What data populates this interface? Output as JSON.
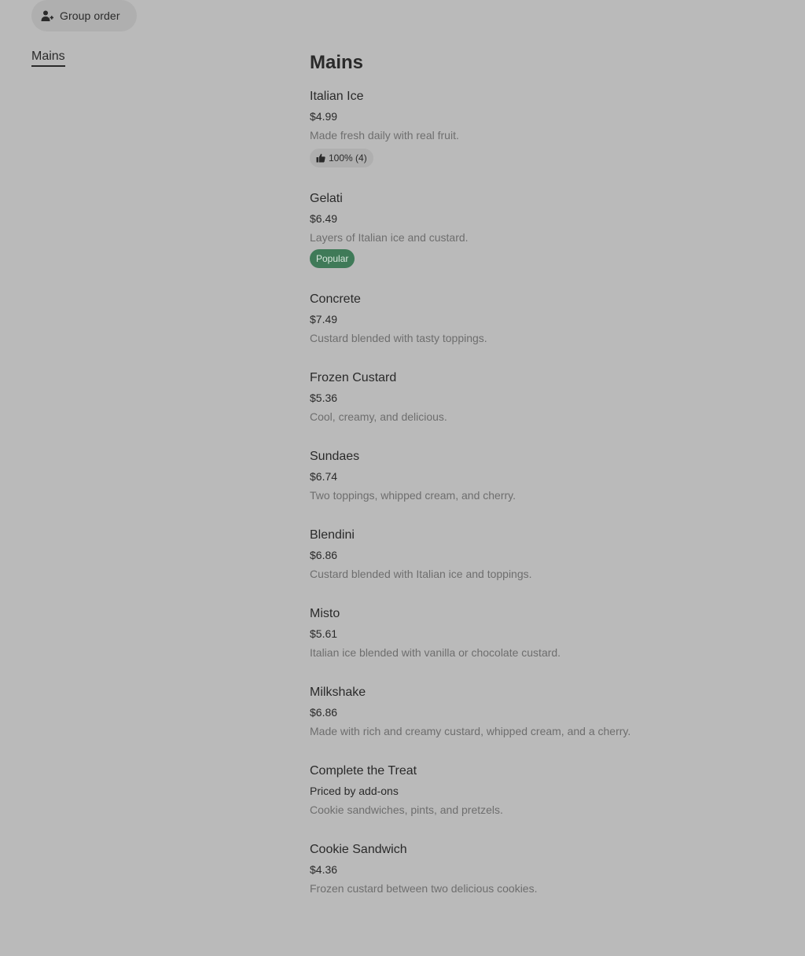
{
  "header": {
    "group_order_label": "Group order",
    "group_order_icon": "person-plus-icon"
  },
  "sidebar": {
    "active_section": "Mains"
  },
  "main": {
    "section_title": "Mains",
    "items": [
      {
        "name": "Italian Ice",
        "price": "$4.99",
        "description": "Made fresh daily with real fruit.",
        "rating": "100% (4)"
      },
      {
        "name": "Gelati",
        "price": "$6.49",
        "description": "Layers of Italian ice and custard.",
        "badge": "Popular"
      },
      {
        "name": "Concrete",
        "price": "$7.49",
        "description": "Custard blended with tasty toppings."
      },
      {
        "name": "Frozen Custard",
        "price": "$5.36",
        "description": "Cool, creamy, and delicious."
      },
      {
        "name": "Sundaes",
        "price": "$6.74",
        "description": "Two toppings, whipped cream, and cherry."
      },
      {
        "name": "Blendini",
        "price": "$6.86",
        "description": "Custard blended with Italian ice and toppings."
      },
      {
        "name": "Misto",
        "price": "$5.61",
        "description": "Italian ice blended with vanilla or chocolate custard."
      },
      {
        "name": "Milkshake",
        "price": "$6.86",
        "description": "Made with rich and creamy custard, whipped cream, and a cherry."
      },
      {
        "name": "Complete the Treat",
        "price": "Priced by add-ons",
        "description": "Cookie sandwiches, pints, and pretzels."
      },
      {
        "name": "Cookie Sandwich",
        "price": "$4.36",
        "description": "Frozen custard between two delicious cookies."
      }
    ]
  },
  "colors": {
    "background": "#bababa",
    "popular_badge": "#3f7a58",
    "rating_badge": "#afafaf"
  }
}
